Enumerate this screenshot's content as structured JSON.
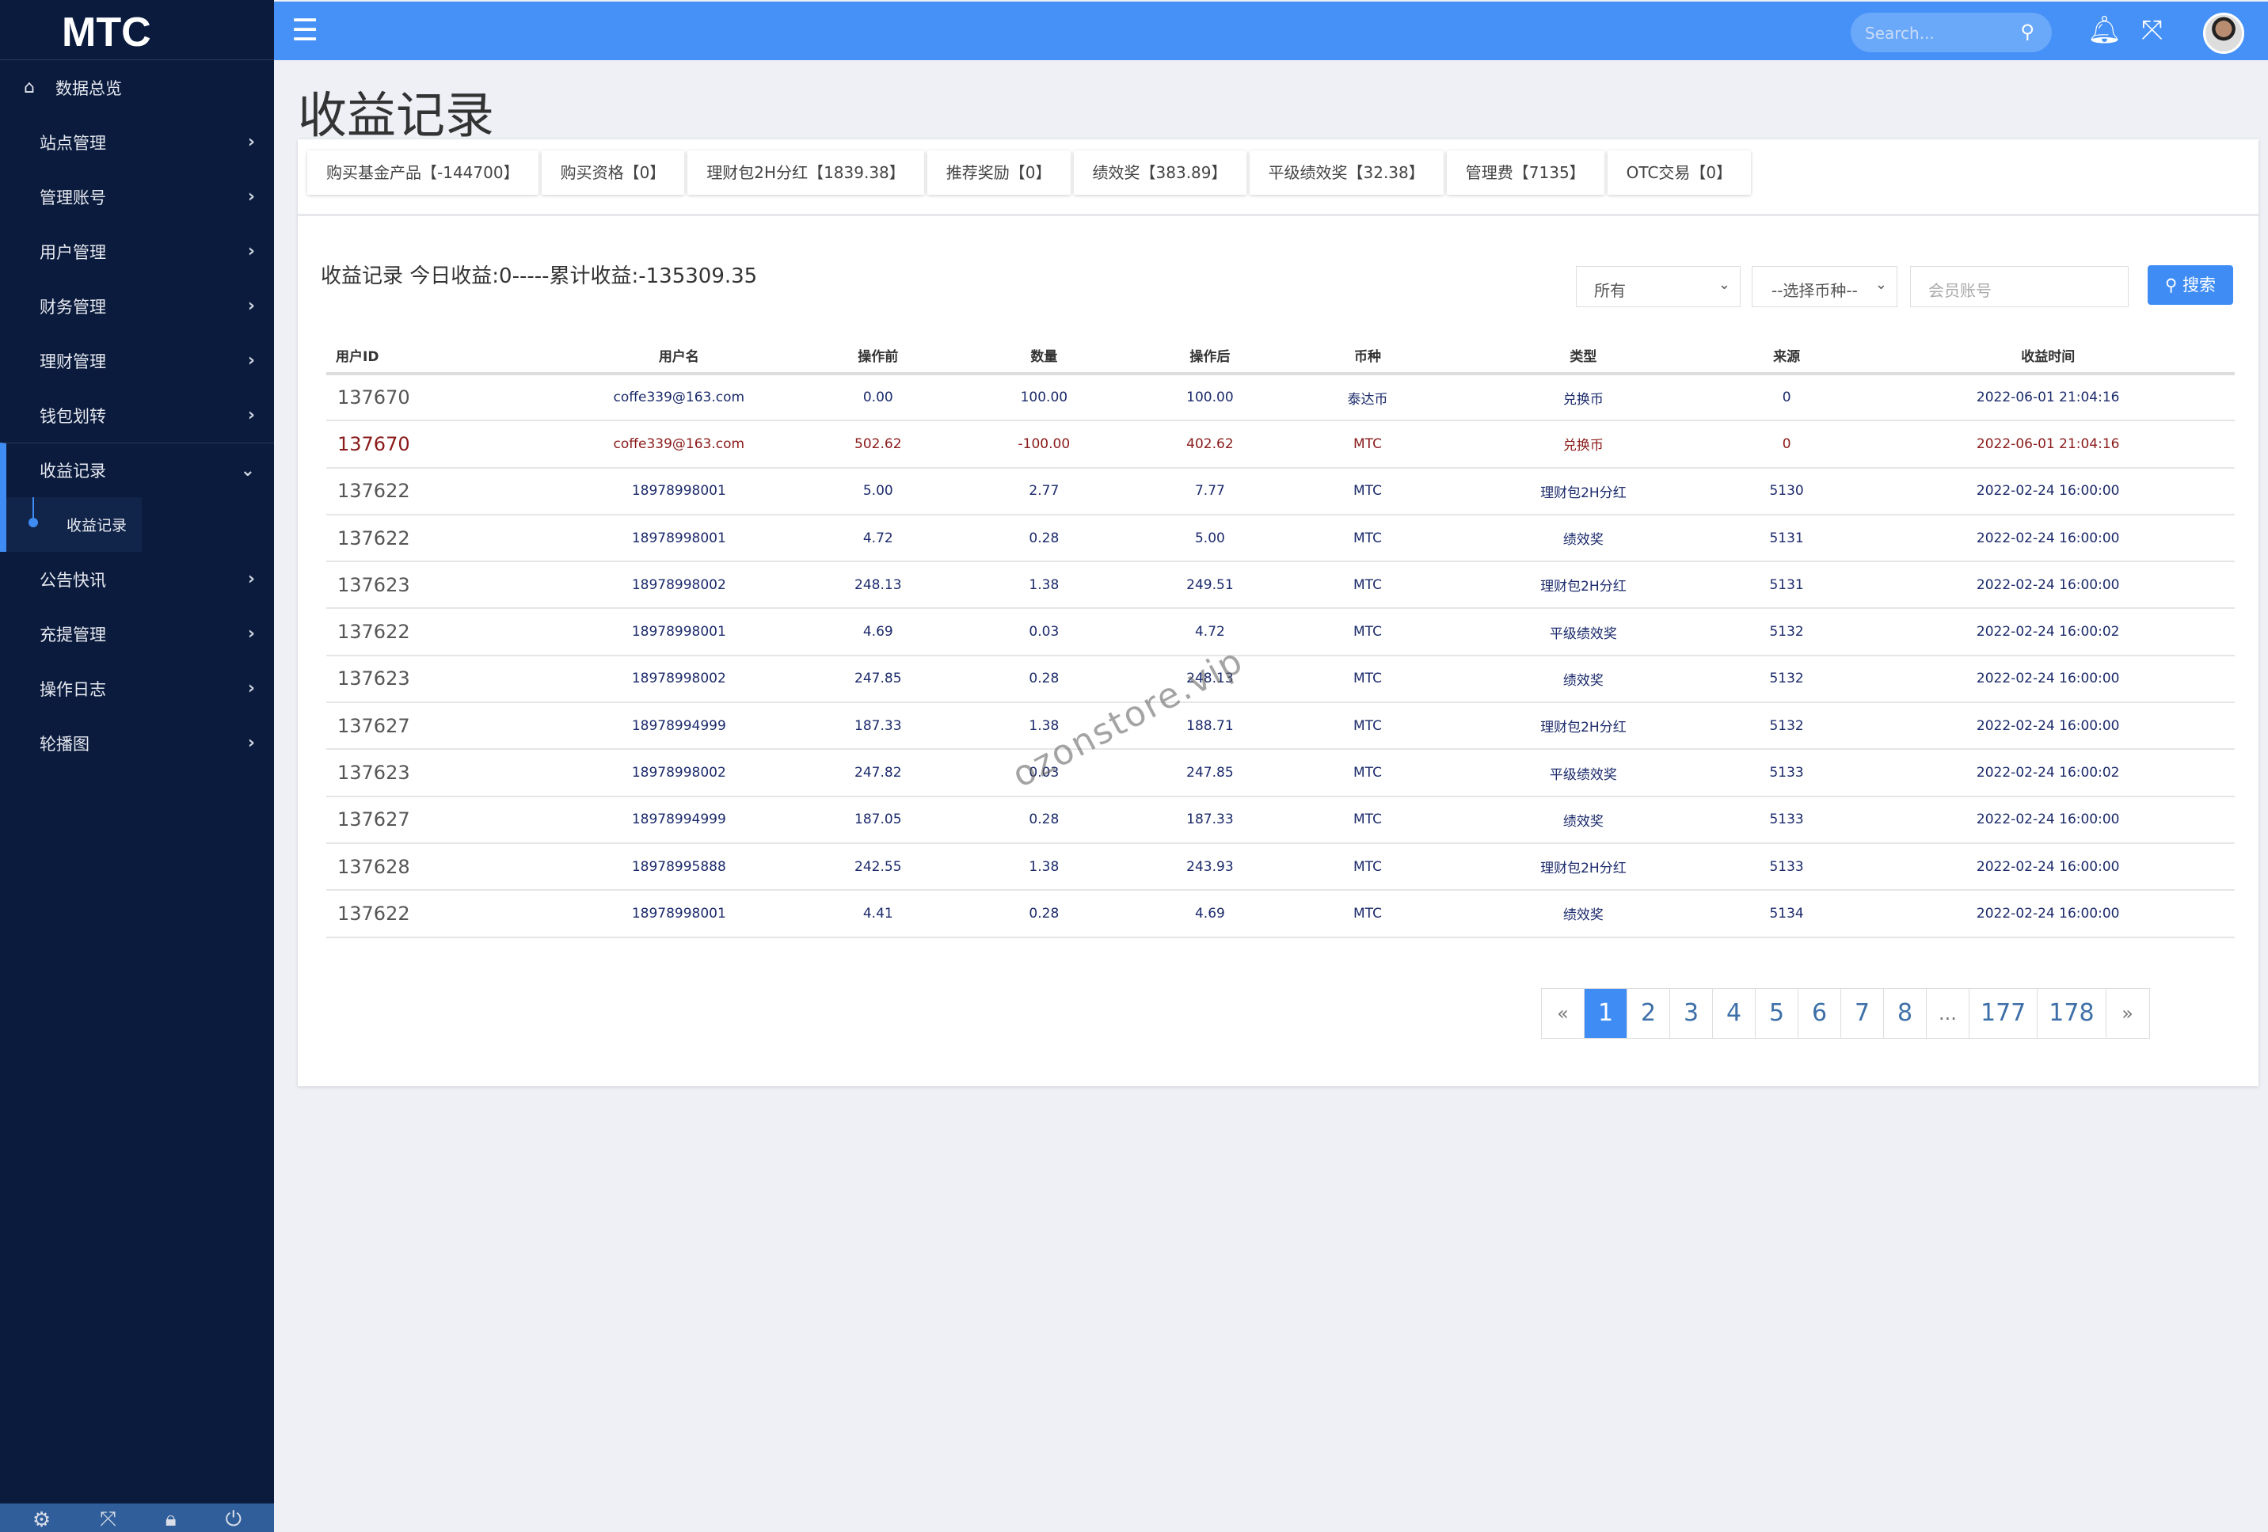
{
  "sidebar": {
    "logo": "MTC",
    "home": "数据总览",
    "items": [
      "站点管理",
      "管理账号",
      "用户管理",
      "财务管理",
      "理财管理",
      "钱包划转"
    ],
    "open": "收益记录",
    "sub": "收益记录",
    "rest": [
      "公告快讯",
      "充提管理",
      "操作日志",
      "轮播图"
    ]
  },
  "topbar": {
    "search_placeholder": "Search..."
  },
  "page": {
    "title": "收益记录"
  },
  "tabs": [
    "购买基金产品【-144700】",
    "购买资格【0】",
    "理财包2H分红【1839.38】",
    "推荐奖励【0】",
    "绩效奖【383.89】",
    "平级绩效奖【32.38】",
    "管理费【7135】",
    "OTC交易【0】"
  ],
  "summary": "收益记录 今日收益:0-----累计收益:-135309.35",
  "filters": {
    "type": "所有",
    "coin": "--选择币种--",
    "account_placeholder": "会员账号",
    "search": "搜索"
  },
  "table": {
    "headers": [
      "用户ID",
      "用户名",
      "操作前",
      "数量",
      "操作后",
      "币种",
      "类型",
      "来源",
      "收益时间"
    ],
    "rows": [
      [
        "137670",
        "coffe339@163.com",
        "0.00",
        "100.00",
        "100.00",
        "泰达币",
        "兑换币",
        "0",
        "2022-06-01 21:04:16"
      ],
      [
        "137670",
        "coffe339@163.com",
        "502.62",
        "-100.00",
        "402.62",
        "MTC",
        "兑换币",
        "0",
        "2022-06-01 21:04:16"
      ],
      [
        "137622",
        "18978998001",
        "5.00",
        "2.77",
        "7.77",
        "MTC",
        "理财包2H分红",
        "5130",
        "2022-02-24 16:00:00"
      ],
      [
        "137622",
        "18978998001",
        "4.72",
        "0.28",
        "5.00",
        "MTC",
        "绩效奖",
        "5131",
        "2022-02-24 16:00:00"
      ],
      [
        "137623",
        "18978998002",
        "248.13",
        "1.38",
        "249.51",
        "MTC",
        "理财包2H分红",
        "5131",
        "2022-02-24 16:00:00"
      ],
      [
        "137622",
        "18978998001",
        "4.69",
        "0.03",
        "4.72",
        "MTC",
        "平级绩效奖",
        "5132",
        "2022-02-24 16:00:02"
      ],
      [
        "137623",
        "18978998002",
        "247.85",
        "0.28",
        "248.13",
        "MTC",
        "绩效奖",
        "5132",
        "2022-02-24 16:00:00"
      ],
      [
        "137627",
        "18978994999",
        "187.33",
        "1.38",
        "188.71",
        "MTC",
        "理财包2H分红",
        "5132",
        "2022-02-24 16:00:00"
      ],
      [
        "137623",
        "18978998002",
        "247.82",
        "0.03",
        "247.85",
        "MTC",
        "平级绩效奖",
        "5133",
        "2022-02-24 16:00:02"
      ],
      [
        "137627",
        "18978994999",
        "187.05",
        "0.28",
        "187.33",
        "MTC",
        "绩效奖",
        "5133",
        "2022-02-24 16:00:00"
      ],
      [
        "137628",
        "18978995888",
        "242.55",
        "1.38",
        "243.93",
        "MTC",
        "理财包2H分红",
        "5133",
        "2022-02-24 16:00:00"
      ],
      [
        "137622",
        "18978998001",
        "4.41",
        "0.28",
        "4.69",
        "MTC",
        "绩效奖",
        "5134",
        "2022-02-24 16:00:00"
      ]
    ]
  },
  "pagination": {
    "prev": "«",
    "pages": [
      "1",
      "2",
      "3",
      "4",
      "5",
      "6",
      "7",
      "8",
      "...",
      "177",
      "178"
    ],
    "current": "1",
    "next": "»"
  },
  "watermark": "ozonstore.vip",
  "colors": {
    "sidebar": "#0b1b3d",
    "accent": "#4591f7",
    "row_text": "#1b2a6b",
    "row_highlight": "#8b1a1a"
  }
}
